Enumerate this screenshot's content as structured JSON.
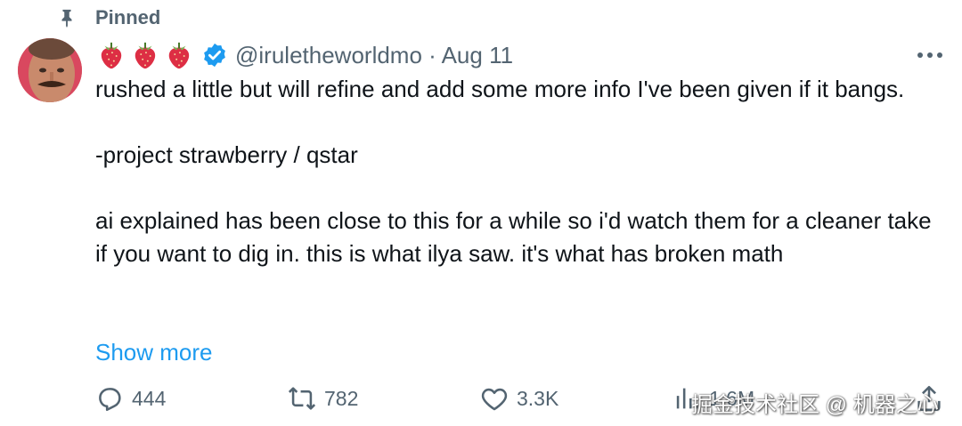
{
  "pinned": {
    "label": "Pinned",
    "icon": "pin-icon"
  },
  "tweet": {
    "avatar_icon": "avatar",
    "emojis": [
      "strawberry-icon",
      "strawberry-icon",
      "strawberry-icon"
    ],
    "verified_icon": "verified-badge-icon",
    "handle_line": "@iruletheworldmo · Aug 11",
    "more_icon": "more-icon",
    "paragraphs": [
      "rushed a little but will refine and add some more info I've been given if it bangs.",
      "-project strawberry / qstar",
      "ai explained has been close to this for a while so i'd watch them for a cleaner take if you want to dig in. this is what ilya saw. it's what has broken math"
    ],
    "show_more": "Show more"
  },
  "actions": {
    "reply": {
      "count": "444",
      "icon": "reply-icon"
    },
    "repost": {
      "count": "782",
      "icon": "repost-icon"
    },
    "like": {
      "count": "3.3K",
      "icon": "heart-icon"
    },
    "views": {
      "count": "1.6M",
      "icon": "views-icon"
    },
    "share": {
      "icon": "share-icon"
    }
  },
  "watermark": "掘金技术社区 @ 机器之心",
  "colors": {
    "text": "#0f1419",
    "muted": "#536471",
    "link": "#1d9bf0"
  }
}
